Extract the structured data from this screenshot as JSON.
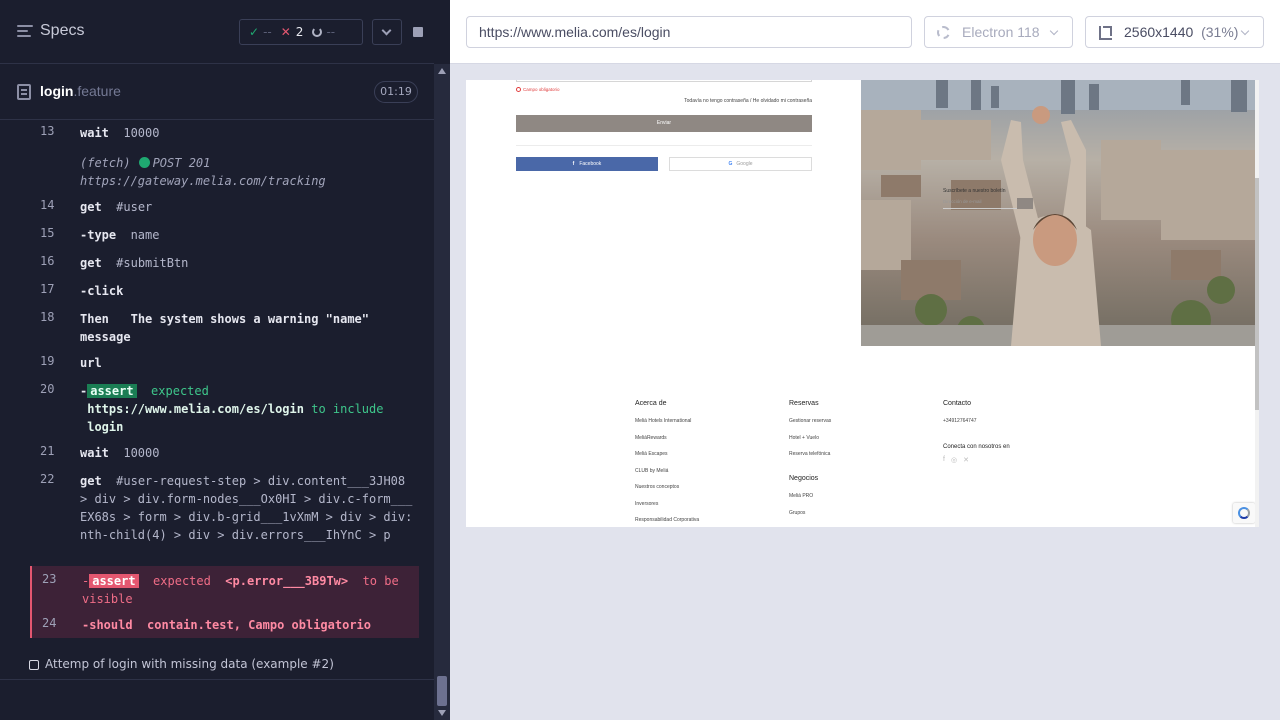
{
  "reporter": {
    "specs_title": "Specs",
    "stats": {
      "passed": "--",
      "failed": "2",
      "pending": "--"
    },
    "file": {
      "name": "login",
      "ext": ".feature",
      "duration": "01:19"
    },
    "commands": [
      {
        "num": "13",
        "kw": "wait",
        "arg": "10000"
      },
      {
        "fetch_label": "(fetch)",
        "fetch_method": "POST 201",
        "fetch_url": "https://gateway.melia.com/tracking"
      },
      {
        "num": "14",
        "kw": "get",
        "arg": "#user"
      },
      {
        "num": "15",
        "kw": "-type",
        "arg": "name"
      },
      {
        "num": "16",
        "kw": "get",
        "arg": "#submitBtn"
      },
      {
        "num": "17",
        "kw": "-click",
        "arg": ""
      },
      {
        "num": "18",
        "kw": "Then",
        "arg": "The system shows a warning \"name\" message"
      },
      {
        "num": "19",
        "kw": "url",
        "arg": ""
      },
      {
        "num": "20",
        "kw": "-",
        "badge": "assert",
        "text1": "expected",
        "url": "https://www.melia.com/es/login",
        "text2": "to include",
        "value": "login"
      },
      {
        "num": "21",
        "kw": "wait",
        "arg": "10000"
      },
      {
        "num": "22",
        "kw": "get",
        "arg": "#user-request-step > div.content___3JH08 > div > div.form-nodes___Ox0HI > div.c-form___EX68s > form > div.b-grid___1vXmM > div > div:nth-child(4) > div > div.errors___IhYnC > p"
      },
      {
        "num": "23",
        "kw": "-",
        "badge": "assert",
        "text1": "expected",
        "value": "<p.error___3B9Tw>",
        "text2": "to be visible"
      },
      {
        "num": "24",
        "kw": "-should",
        "arg": "contain.test, Campo obligatorio"
      }
    ],
    "example": "Attemp of login with missing data (example #2)"
  },
  "aut": {
    "url": "https://www.melia.com/es/login",
    "browser": "Electron 118",
    "viewport": "2560x1440",
    "scale": "(31%)"
  },
  "page": {
    "field_error": "Campo obligatorio",
    "forgot_links": "Todavía no tengo contraseña / He olvidado mi contraseña",
    "send_button": "Enviar",
    "facebook_button": "Facebook",
    "google_button": "Google",
    "footer": {
      "col1": {
        "title": "Acerca de",
        "items": [
          "Meliá Hotels International",
          "MeliáRewards",
          "Meliá Escapes",
          "CLUB by Meliá",
          "Nuestros conceptos",
          "Inversores",
          "Responsabilidad Corporativa"
        ]
      },
      "col2": {
        "title": "Reservas",
        "items": [
          "Gestionar reservas",
          "Hotel + Vuelo",
          "Reserva telefónica"
        ],
        "title2": "Negocios",
        "items2": [
          "Meliá PRO",
          "Grupos"
        ]
      },
      "col3": {
        "title": "Contacto",
        "phone": "+34912764747",
        "social_title": "Conecta con nosotros en",
        "newsletter": "Suscríbete a nuestro boletín",
        "newsletter_placeholder": "Dirección de e-mail"
      }
    }
  }
}
